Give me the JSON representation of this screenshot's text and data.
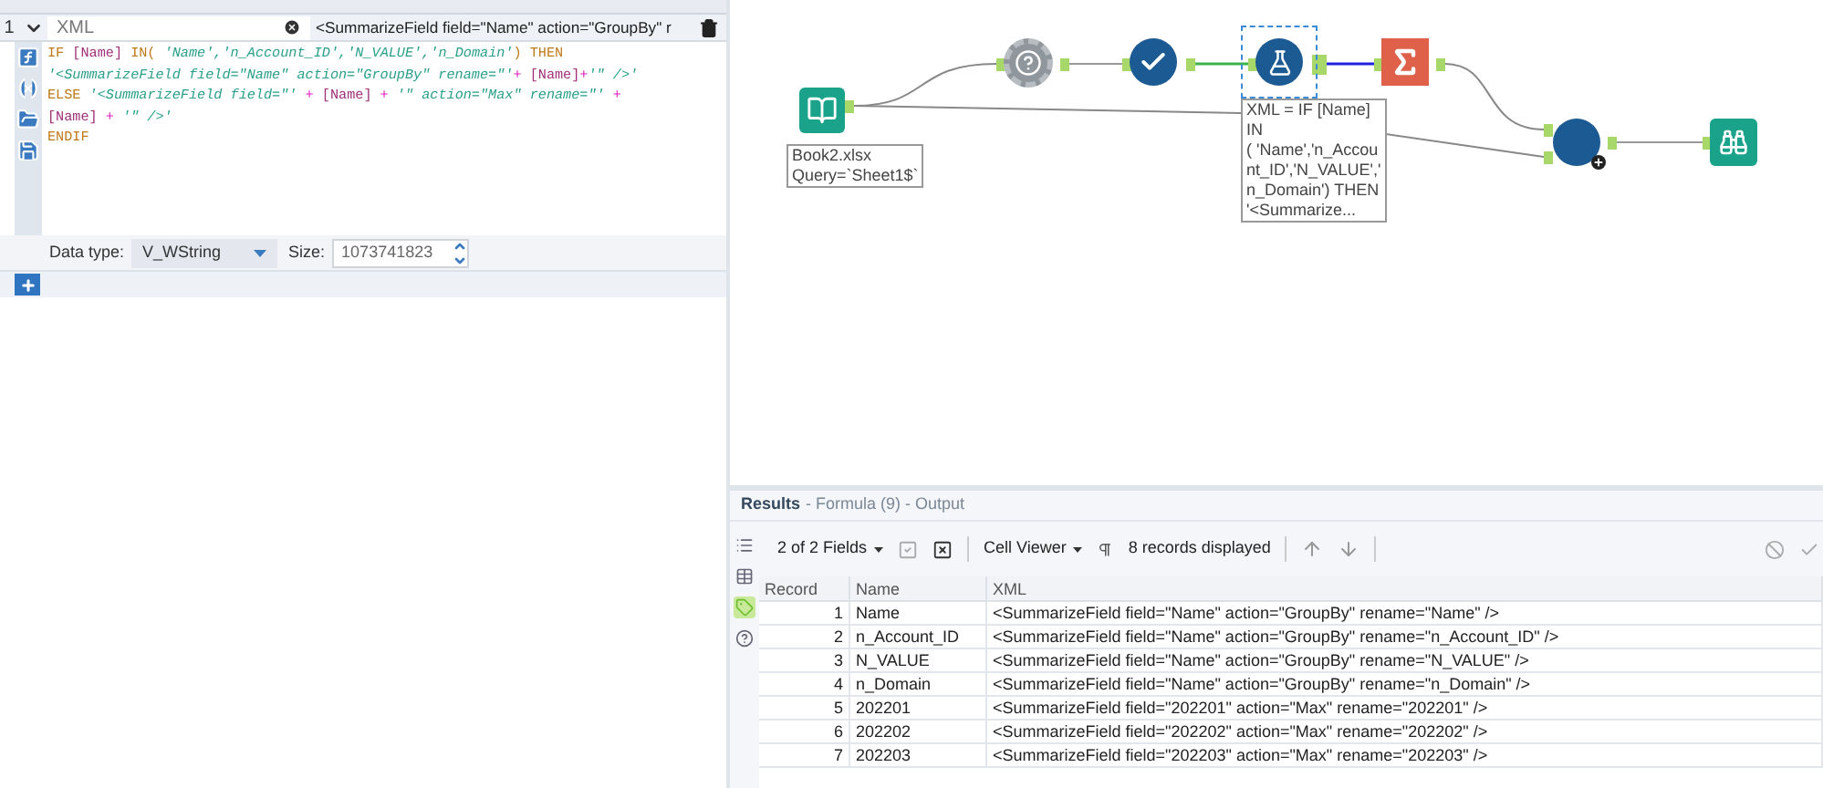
{
  "formula_editor": {
    "row_number": "1",
    "expanded": true,
    "output_column": "XML",
    "data_preview": "<SummarizeField field=\"Name\" action=\"GroupBy\" r",
    "code_lines": [
      [
        {
          "kind": "keyword",
          "text": "IF "
        },
        {
          "kind": "field",
          "text": "[Name]"
        },
        {
          "kind": "keyword",
          "text": " IN( "
        },
        {
          "kind": "string",
          "text": "'Name'"
        },
        {
          "kind": "string",
          "text": ","
        },
        {
          "kind": "string",
          "text": "'n_Account_ID'"
        },
        {
          "kind": "string",
          "text": ","
        },
        {
          "kind": "string",
          "text": "'N_VALUE'"
        },
        {
          "kind": "string",
          "text": ","
        },
        {
          "kind": "string",
          "text": "'n_Domain'"
        },
        {
          "kind": "keyword",
          "text": ") THEN"
        }
      ],
      [
        {
          "kind": "string",
          "text": "'<SummarizeField field=\"Name\" action=\"GroupBy\" rename=\"'"
        },
        {
          "kind": "operator",
          "text": "+ "
        },
        {
          "kind": "field",
          "text": "[Name]"
        },
        {
          "kind": "operator",
          "text": "+"
        },
        {
          "kind": "string",
          "text": "'\" />'"
        }
      ],
      [
        {
          "kind": "keyword",
          "text": "ELSE "
        },
        {
          "kind": "string",
          "text": "'<SummarizeField field=\"'"
        },
        {
          "kind": "operator",
          "text": " + "
        },
        {
          "kind": "field",
          "text": "[Name]"
        },
        {
          "kind": "operator",
          "text": " + "
        },
        {
          "kind": "string",
          "text": "'\" action=\"Max\" rename=\"'"
        },
        {
          "kind": "operator",
          "text": " +"
        }
      ],
      [
        {
          "kind": "field",
          "text": "[Name]"
        },
        {
          "kind": "operator",
          "text": " + "
        },
        {
          "kind": "string",
          "text": "'\" />'"
        }
      ],
      [
        {
          "kind": "keyword",
          "text": "ENDIF"
        }
      ]
    ],
    "data_type_label": "Data type:",
    "data_type": "V_WString",
    "size_label": "Size:",
    "size": "1073741823"
  },
  "canvas": {
    "nodes": [
      {
        "kind": "input",
        "selected": false,
        "annotation": [
          "Book2.xlsx",
          "Query=`Sheet1$`"
        ]
      },
      {
        "kind": "unknown",
        "selected": false
      },
      {
        "kind": "select",
        "selected": false
      },
      {
        "kind": "formula",
        "selected": true,
        "annotation": [
          "XML = IF [Name]",
          "IN",
          "( 'Name','n_Accou",
          "nt_ID','N_VALUE','",
          "n_Domain') THEN",
          "'<Summarize..."
        ]
      },
      {
        "kind": "summarize",
        "selected": false
      },
      {
        "kind": "join",
        "selected": false
      },
      {
        "kind": "browse",
        "selected": false
      }
    ]
  },
  "results": {
    "title": "Results",
    "subtitle": "- Formula (9) - Output",
    "side_tabs": [
      {
        "kind": "list",
        "selected": false
      },
      {
        "kind": "table",
        "selected": false
      },
      {
        "kind": "tag",
        "selected": true
      },
      {
        "kind": "help",
        "selected": false
      }
    ],
    "fields_selector": "2 of 2 Fields",
    "viewer": "Cell Viewer",
    "records_count": "8 records displayed",
    "columns": [
      "Record",
      "Name",
      "XML"
    ],
    "rows": [
      [
        "1",
        "Name",
        "<SummarizeField field=\"Name\" action=\"GroupBy\" rename=\"Name\" />"
      ],
      [
        "2",
        "n_Account_ID",
        "<SummarizeField field=\"Name\" action=\"GroupBy\" rename=\"n_Account_ID\" />"
      ],
      [
        "3",
        "N_VALUE",
        "<SummarizeField field=\"Name\" action=\"GroupBy\" rename=\"N_VALUE\" />"
      ],
      [
        "4",
        "n_Domain",
        "<SummarizeField field=\"Name\" action=\"GroupBy\" rename=\"n_Domain\" />"
      ],
      [
        "5",
        "202201",
        "<SummarizeField field=\"202201\" action=\"Max\" rename=\"202201\" />"
      ],
      [
        "6",
        "202202",
        "<SummarizeField field=\"202202\" action=\"Max\" rename=\"202202\" />"
      ],
      [
        "7",
        "202203",
        "<SummarizeField field=\"202203\" action=\"Max\" rename=\"202203\" />"
      ]
    ]
  }
}
